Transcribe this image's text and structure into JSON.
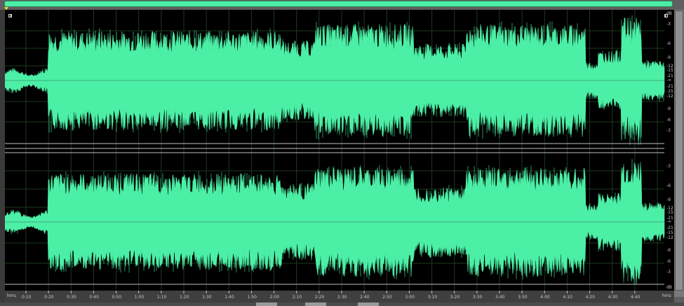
{
  "colors": {
    "waveform": "#4cefa6",
    "background": "#000000",
    "grid": "#1d3a1d",
    "separator": "#c0c0c0",
    "label": "#c8c8c8"
  },
  "ruler": {
    "start_label": "hms",
    "end_label": "hms",
    "ticks": [
      "0:10",
      "0:20",
      "0:30",
      "0:40",
      "0:50",
      "1:00",
      "1:10",
      "1:20",
      "1:30",
      "1:40",
      "1:50",
      "2:00",
      "2:10",
      "2:20",
      "2:30",
      "2:40",
      "2:50",
      "3:00",
      "3:10",
      "3:20",
      "3:30",
      "3:40",
      "3:50",
      "4:00",
      "4:10",
      "4:20",
      "4:30",
      "4:40"
    ]
  },
  "db_scale": {
    "unit": "dB",
    "upper": [
      "-3",
      "-6",
      "-9",
      "-12",
      "-15",
      "-21",
      "-∞"
    ],
    "lower": [
      "-21",
      "-15",
      "-12",
      "-9",
      "-6",
      "-3"
    ]
  },
  "icons": {
    "channel_top_left": "channel-toggle-icon",
    "channel_top_right": "channel-toggle-icon"
  }
}
